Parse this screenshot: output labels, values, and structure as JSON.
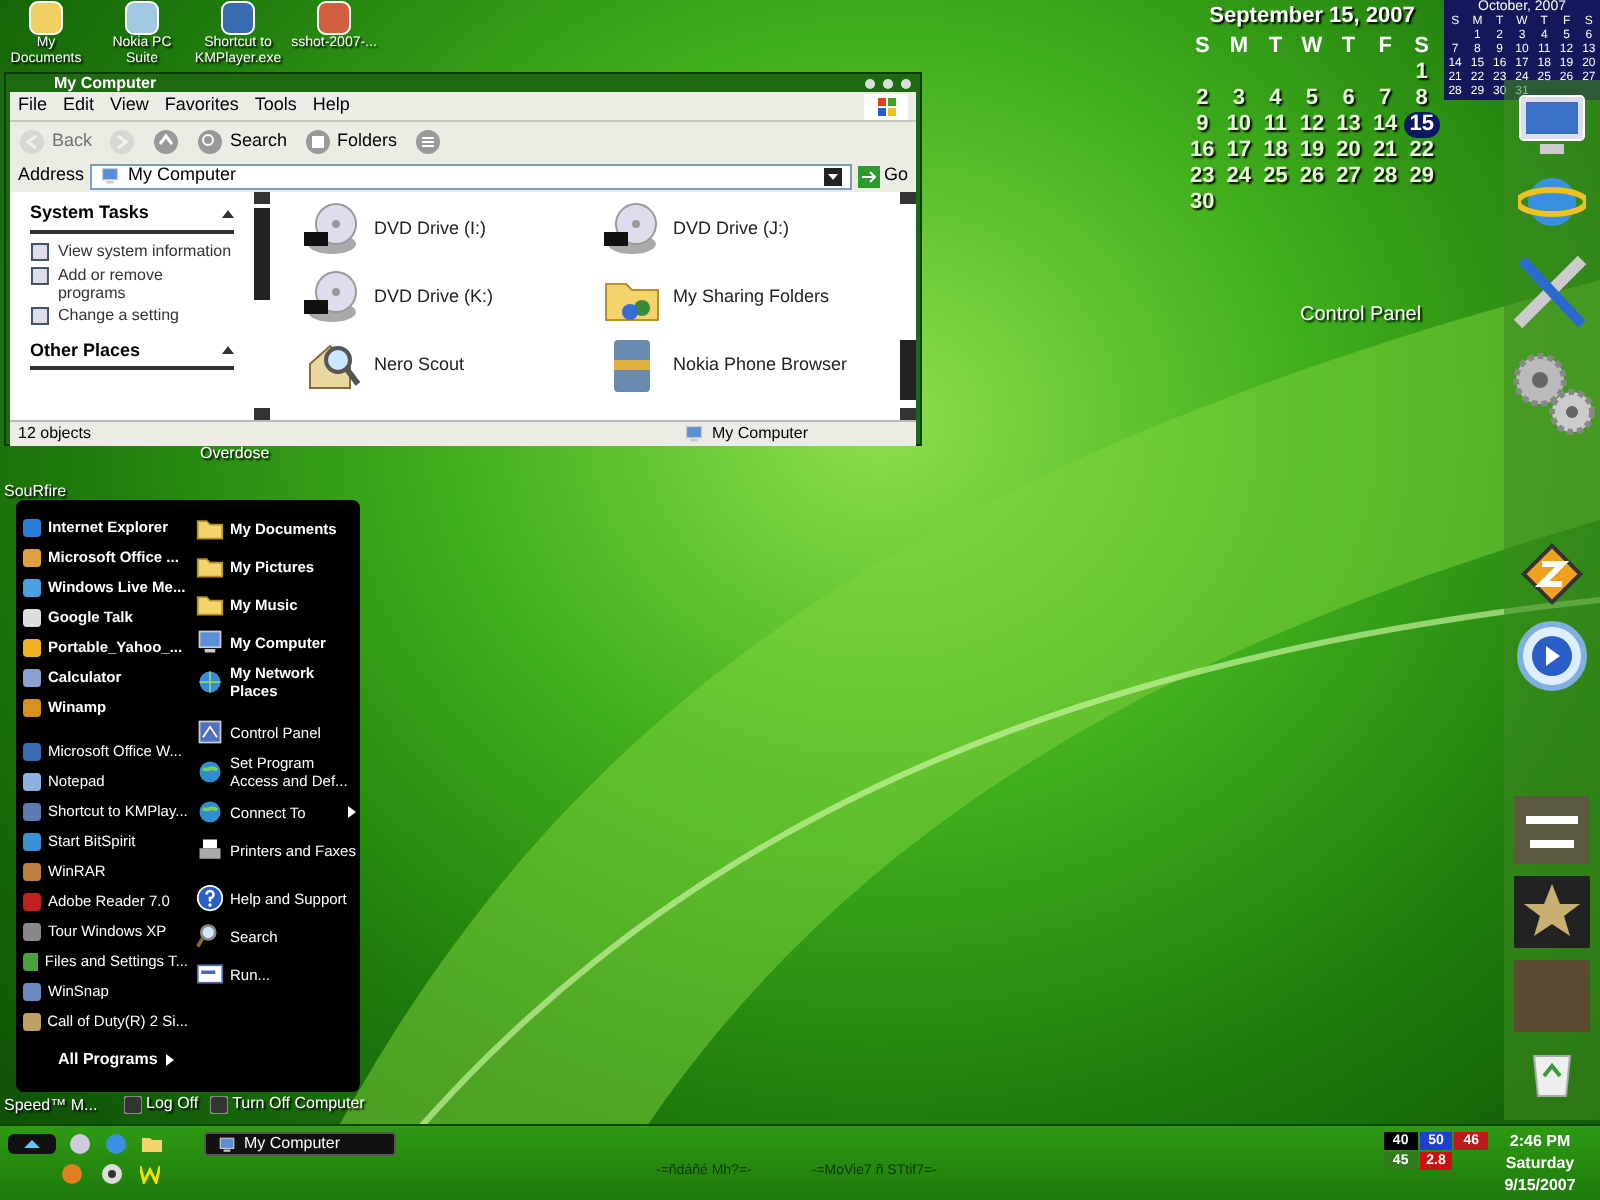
{
  "desktop_icons": [
    {
      "label": "My Documents"
    },
    {
      "label": "Nokia PC Suite"
    },
    {
      "label": "Shortcut to KMPlayer.exe"
    },
    {
      "label": "sshot-2007-..."
    }
  ],
  "hidden_labels": [
    "Overdose",
    "SouRfire",
    "Speed™ M..."
  ],
  "window": {
    "title": "My Computer",
    "menu": [
      "File",
      "Edit",
      "View",
      "Favorites",
      "Tools",
      "Help"
    ],
    "toolbar": [
      {
        "kind": "back",
        "label": "Back",
        "disabled": true
      },
      {
        "kind": "forward",
        "disabled": true
      },
      {
        "kind": "up",
        "disabled": false
      },
      {
        "kind": "search",
        "label": "Search",
        "disabled": false
      },
      {
        "kind": "folders",
        "label": "Folders",
        "disabled": false
      },
      {
        "kind": "views",
        "disabled": false
      }
    ],
    "address": {
      "label": "Address",
      "value": "My Computer",
      "go": "Go"
    },
    "task_panes": [
      {
        "title": "System Tasks",
        "expanded": true,
        "items": [
          "View system information",
          "Add or remove programs",
          "Change a setting"
        ]
      },
      {
        "title": "Other Places",
        "expanded": true
      }
    ],
    "items": [
      {
        "label": "DVD Drive (I:)",
        "kind": "dvd"
      },
      {
        "label": "DVD Drive (J:)",
        "kind": "dvd"
      },
      {
        "label": "DVD Drive (K:)",
        "kind": "dvd"
      },
      {
        "label": "My Sharing Folders",
        "kind": "shared"
      },
      {
        "label": "Nero Scout",
        "kind": "house"
      },
      {
        "label": "Nokia Phone Browser",
        "kind": "phone"
      }
    ],
    "status_bar": {
      "count": "12 objects",
      "location": "My Computer"
    }
  },
  "start_menu": {
    "pinned": [
      "Internet Explorer",
      "Microsoft Office ...",
      "Windows Live Me...",
      "Google Talk",
      "Portable_Yahoo_...",
      "Calculator",
      "Winamp"
    ],
    "recent": [
      "Microsoft Office W...",
      "Notepad",
      "Shortcut to KMPlay...",
      "Start BitSpirit",
      "WinRAR",
      "Adobe Reader 7.0",
      "Tour Windows XP",
      "Files and Settings T...",
      "WinSnap",
      "Call of Duty(R) 2 Si..."
    ],
    "all_programs": "All Programs",
    "right_groups": [
      {
        "items": [
          {
            "label": "My Documents",
            "kind": "folder"
          },
          {
            "label": "My Pictures",
            "kind": "folder"
          },
          {
            "label": "My Music",
            "kind": "folder"
          },
          {
            "label": "My Computer",
            "kind": "computer"
          },
          {
            "label": "My Network Places",
            "kind": "network"
          }
        ]
      },
      {
        "items": [
          {
            "label": "Control Panel",
            "kind": "panel"
          },
          {
            "label": "Set Program Access and Def...",
            "kind": "globe"
          },
          {
            "label": "Connect To",
            "kind": "globe",
            "submenu": true
          },
          {
            "label": "Printers and Faxes",
            "kind": "printer"
          }
        ]
      },
      {
        "items": [
          {
            "label": "Help and Support",
            "kind": "help"
          },
          {
            "label": "Search",
            "kind": "search"
          },
          {
            "label": "Run...",
            "kind": "run"
          }
        ]
      }
    ],
    "footer": [
      "Log Off",
      "Turn Off Computer"
    ]
  },
  "calendar": {
    "title": "September 15, 2007",
    "weekdays": [
      "S",
      "M",
      "T",
      "W",
      "T",
      "F",
      "S"
    ],
    "weeks": [
      [
        {
          "day": "1",
          "selected": false
        }
      ],
      [
        {
          "day": "2",
          "selected": false
        },
        {
          "day": "3",
          "selected": false
        },
        {
          "day": "4",
          "selected": false
        },
        {
          "day": "5",
          "selected": false
        },
        {
          "day": "6",
          "selected": false
        },
        {
          "day": "7",
          "selected": false
        },
        {
          "day": "8",
          "selected": false
        }
      ],
      [
        {
          "day": "9",
          "selected": false
        },
        {
          "day": "10",
          "selected": false
        },
        {
          "day": "11",
          "selected": false
        },
        {
          "day": "12",
          "selected": false
        },
        {
          "day": "13",
          "selected": false
        },
        {
          "day": "14",
          "selected": false
        },
        {
          "day": "15",
          "selected": true
        }
      ],
      [
        {
          "day": "16",
          "selected": false
        },
        {
          "day": "17",
          "selected": false
        },
        {
          "day": "18",
          "selected": false
        },
        {
          "day": "19",
          "selected": false
        },
        {
          "day": "20",
          "selected": false
        },
        {
          "day": "21",
          "selected": false
        },
        {
          "day": "22",
          "selected": false
        }
      ],
      [
        {
          "day": "23",
          "selected": false
        },
        {
          "day": "24",
          "selected": false
        },
        {
          "day": "25",
          "selected": false
        },
        {
          "day": "26",
          "selected": false
        },
        {
          "day": "27",
          "selected": false
        },
        {
          "day": "28",
          "selected": false
        },
        {
          "day": "29",
          "selected": false
        }
      ],
      [
        {
          "day": "30",
          "selected": false
        }
      ]
    ]
  },
  "mini_calendar": {
    "title": "October, 2007",
    "weekdays": [
      "S",
      "M",
      "T",
      "W",
      "T",
      "F",
      "S"
    ],
    "weeks": [
      [
        "1",
        "2",
        "3",
        "4",
        "5",
        "6"
      ],
      [
        "7",
        "8",
        "9",
        "10",
        "11",
        "12",
        "13"
      ],
      [
        "14",
        "15",
        "16",
        "17",
        "18",
        "19",
        "20"
      ],
      [
        "21",
        "22",
        "23",
        "24",
        "25",
        "26",
        "27"
      ],
      [
        "28",
        "29",
        "30",
        "31"
      ]
    ]
  },
  "desktop_label": "Control Panel",
  "taskbar": {
    "tasks": [
      {
        "label": "My Computer",
        "selected": true
      }
    ],
    "toolbars": [
      "-=ñdáñé Mh?=-",
      "-=MoVie7 ñ STtif7=-"
    ],
    "tray_badges": [
      {
        "label": "40",
        "color": "#000000"
      },
      {
        "label": "50",
        "color": "#1f3fd0"
      },
      {
        "label": "46",
        "color": "#c01818"
      },
      {
        "label": "45",
        "color": "#2e7d1a"
      },
      {
        "label": "2.8",
        "color": "#d01010"
      }
    ],
    "clock": {
      "time": "2:46 PM",
      "day": "Saturday",
      "date": "9/15/2007"
    }
  }
}
